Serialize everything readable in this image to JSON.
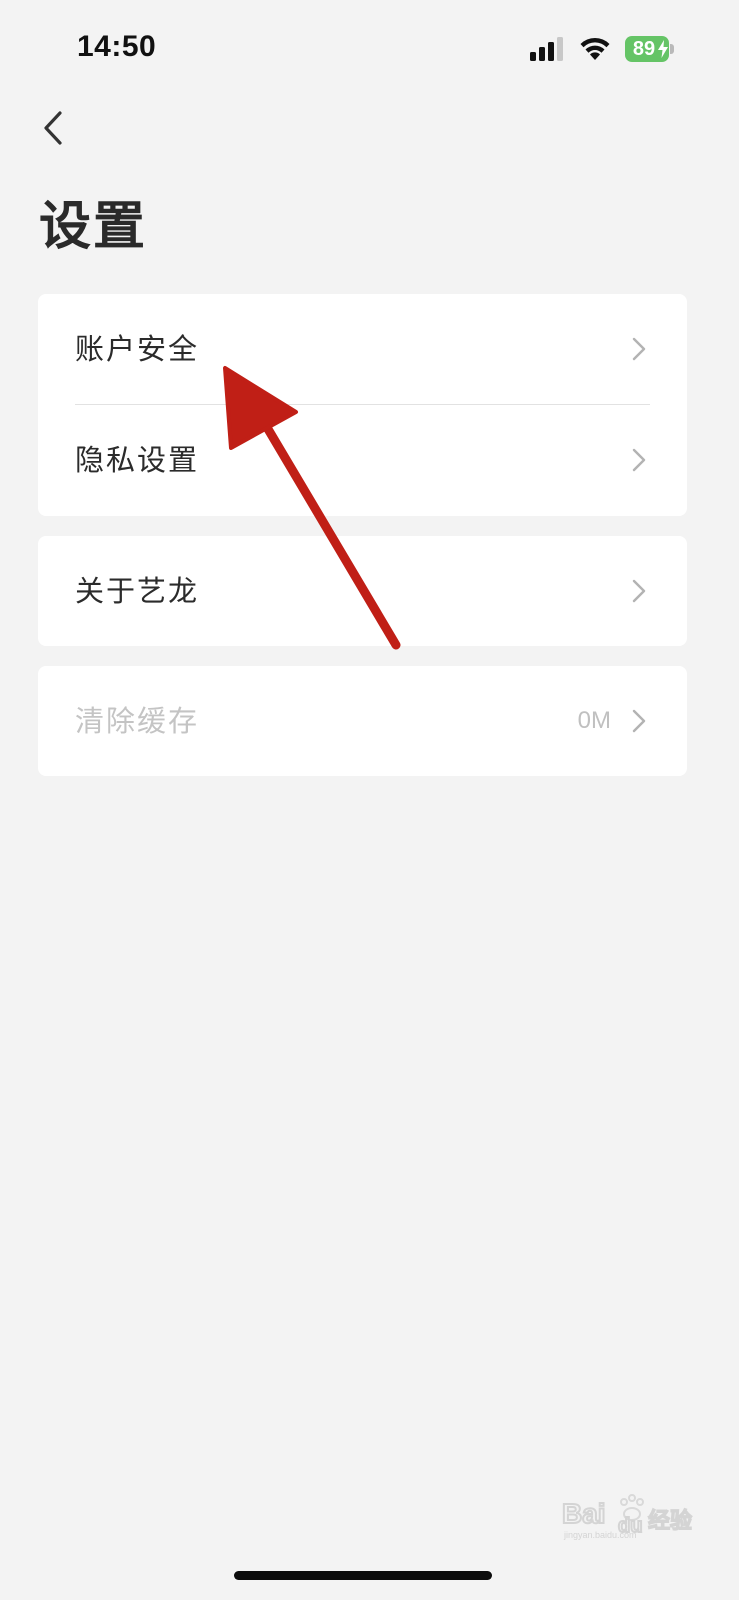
{
  "status_bar": {
    "time": "14:50",
    "battery_percent": "89",
    "icons": [
      "cellular-signal-icon",
      "wifi-icon",
      "battery-icon",
      "charging-bolt-icon"
    ],
    "battery_color": "#65c466"
  },
  "nav": {
    "back_icon": "chevron-left-icon"
  },
  "page": {
    "title": "设置"
  },
  "settings": {
    "groups": [
      {
        "items": [
          {
            "label": "账户安全"
          },
          {
            "label": "隐私设置"
          }
        ]
      },
      {
        "items": [
          {
            "label": "关于艺龙"
          }
        ]
      },
      {
        "items": [
          {
            "label": "清除缓存",
            "value": "0M",
            "disabled": true
          }
        ]
      }
    ]
  },
  "annotation": {
    "type": "arrow",
    "color": "#c01f16",
    "points_to": "账户安全"
  },
  "watermark": {
    "text": "Baidu经验",
    "subtext": "jingyan.baidu.com"
  },
  "colors": {
    "background": "#f3f3f3",
    "card": "#ffffff",
    "text": "#2b2b2b",
    "disabled_text": "#c4c4c4",
    "chevron": "#b3b3b3"
  }
}
